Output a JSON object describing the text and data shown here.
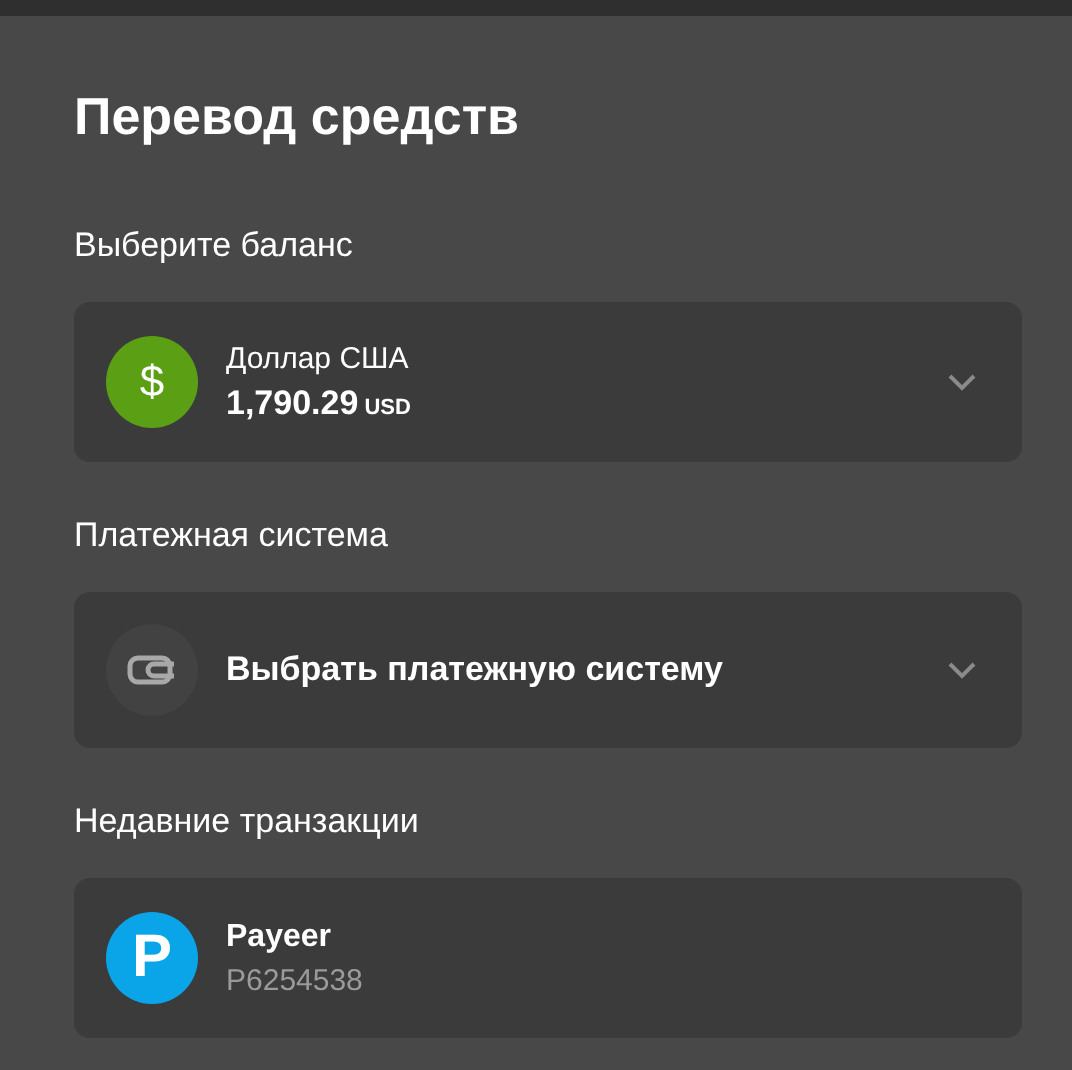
{
  "title": "Перевод средств",
  "sections": [
    {
      "label": "Выберите баланс",
      "card": {
        "kind": "currency",
        "icon_text": "$",
        "color": "#5a9f14",
        "name": "Доллар США",
        "amount": "1,790.29",
        "unit": "USD"
      }
    },
    {
      "label": "Платежная система",
      "card": {
        "kind": "placeholder",
        "text": "Выбрать платежную систему"
      }
    },
    {
      "label": "Недавние транзакции",
      "card": {
        "kind": "transaction",
        "icon_text": "P",
        "color": "#0aa5e8",
        "name": "Payeer",
        "account": "P6254538"
      }
    }
  ]
}
